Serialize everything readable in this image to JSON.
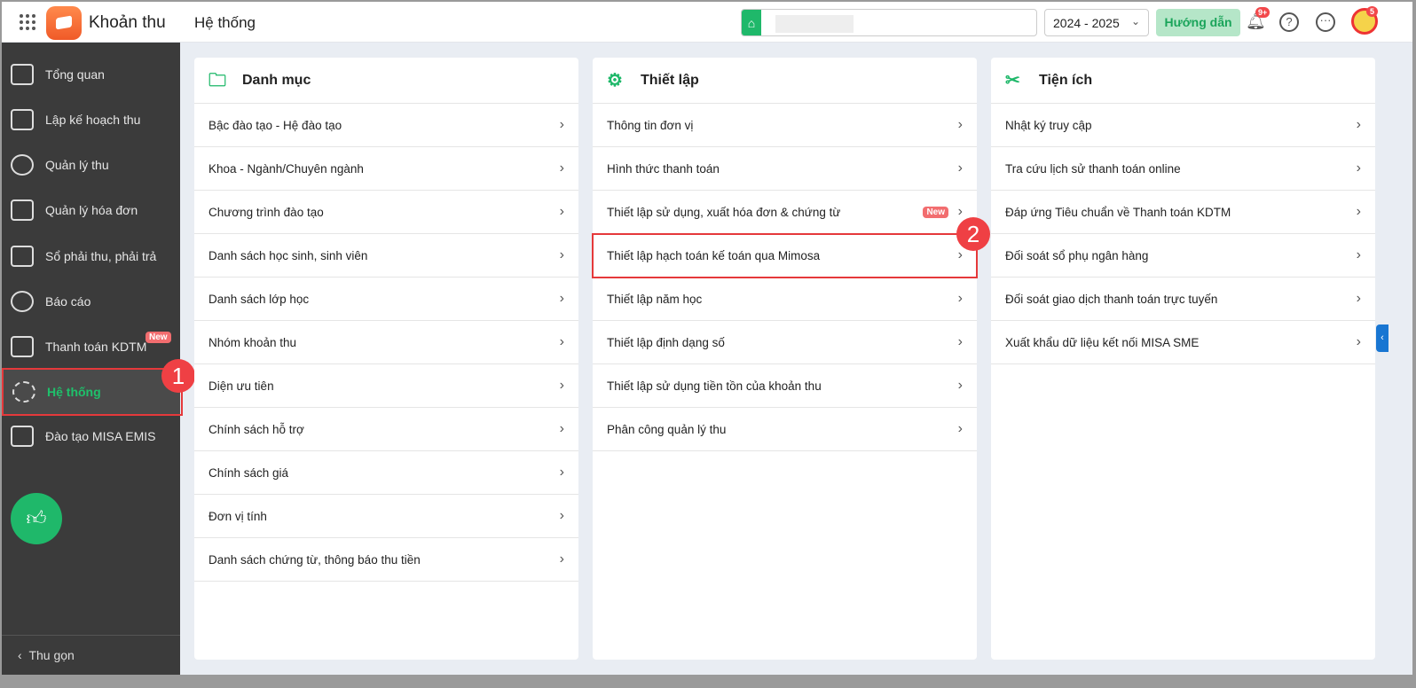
{
  "header": {
    "app_name": "Khoản thu",
    "breadcrumb": "Hệ thống",
    "year": "2024 - 2025",
    "guide": "Hướng dẫn",
    "notif_badge": "9+",
    "avatar_badge": "5",
    "help": "?",
    "more": "···"
  },
  "sidebar": {
    "items": [
      {
        "label": "Tổng quan"
      },
      {
        "label": "Lập kế hoạch thu"
      },
      {
        "label": "Quản lý thu"
      },
      {
        "label": "Quản lý hóa đơn"
      },
      {
        "label": "Sổ phải thu, phải trả"
      },
      {
        "label": "Báo cáo"
      },
      {
        "label": "Thanh toán KDTM"
      },
      {
        "label": "Hệ thống"
      },
      {
        "label": "Đào tạo MISA EMIS"
      }
    ],
    "new_badge": "New",
    "collapse": "Thu gọn"
  },
  "annotations": {
    "step1": "1",
    "step2": "2"
  },
  "cards": [
    {
      "title": "Danh mục",
      "items": [
        "Bậc đào tạo - Hệ đào tạo",
        "Khoa - Ngành/Chuyên ngành",
        "Chương trình đào tạo",
        "Danh sách học sinh, sinh viên",
        "Danh sách lớp học",
        "Nhóm khoản thu",
        "Diện ưu tiên",
        "Chính sách hỗ trợ",
        "Chính sách giá",
        "Đơn vị tính",
        "Danh sách chứng từ, thông báo thu tiền"
      ]
    },
    {
      "title": "Thiết lập",
      "items": [
        "Thông tin đơn vị",
        "Hình thức thanh toán",
        "Thiết lập sử dụng, xuất hóa đơn & chứng từ",
        "Thiết lập hạch toán kế toán qua Mimosa",
        "Thiết lập năm học",
        "Thiết lập định dạng số",
        "Thiết lập sử dụng tiền tồn của khoản thu",
        "Phân công quản lý thu"
      ],
      "new_badge": "New"
    },
    {
      "title": "Tiện ích",
      "items": [
        "Nhật ký truy cập",
        "Tra cứu lịch sử thanh toán online",
        "Đáp ứng Tiêu chuẩn về Thanh toán KDTM",
        "Đối soát sổ phụ ngân hàng",
        "Đối soát giao dịch thanh toán trực tuyến",
        "Xuất khẩu dữ liệu kết nối MISA SME"
      ]
    }
  ]
}
